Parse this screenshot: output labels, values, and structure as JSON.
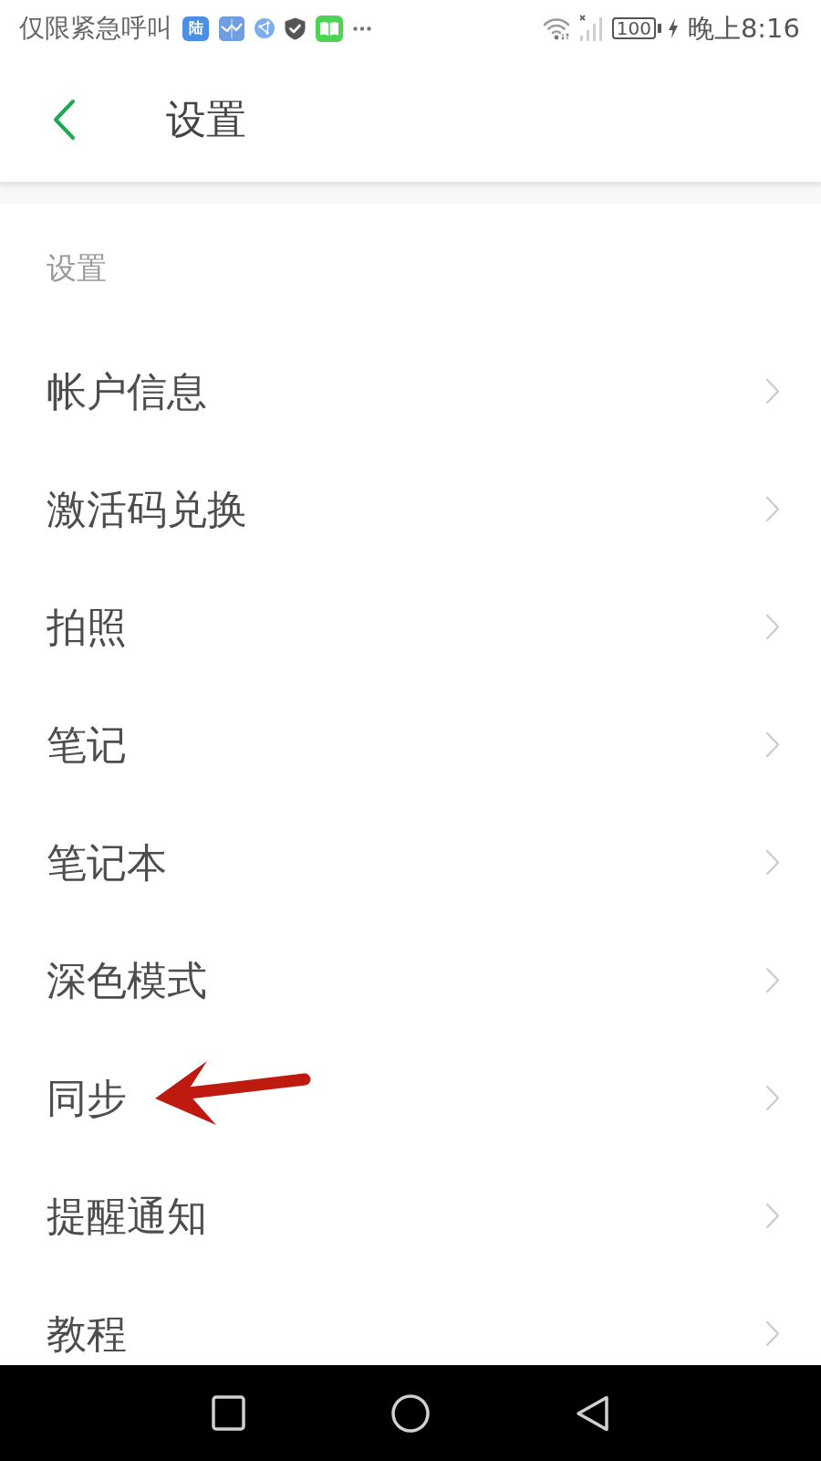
{
  "status_bar": {
    "notice": "仅限紧急呼叫",
    "app_badge": "陆",
    "battery": "100",
    "time": "晚上8:16"
  },
  "header": {
    "title": "设置"
  },
  "section": {
    "title": "设置",
    "items": [
      {
        "label": "帐户信息",
        "annotated": false
      },
      {
        "label": "激活码兑换",
        "annotated": false
      },
      {
        "label": "拍照",
        "annotated": false
      },
      {
        "label": "笔记",
        "annotated": false
      },
      {
        "label": "笔记本",
        "annotated": false
      },
      {
        "label": "深色模式",
        "annotated": false
      },
      {
        "label": "同步",
        "annotated": true
      },
      {
        "label": "提醒通知",
        "annotated": false
      },
      {
        "label": "教程",
        "annotated": false
      }
    ]
  }
}
